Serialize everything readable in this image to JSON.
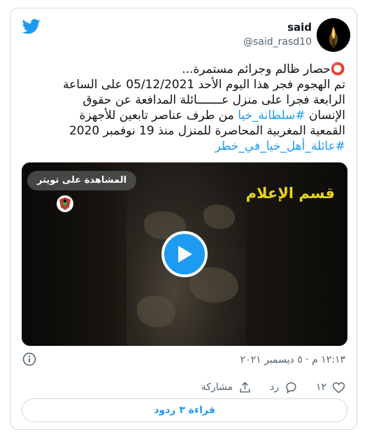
{
  "author": {
    "name": "said",
    "handle": "@said_rasd10"
  },
  "tweet": {
    "lines": [
      {
        "parts": [
          {
            "text": "⭕حصار ظالم  وجرائم مستمرة...",
            "hl": false
          }
        ]
      },
      {
        "parts": [
          {
            "text": "تم الهجوم فجر هذا اليوم الأحد 05/12/2021 على الساعة",
            "hl": false
          }
        ]
      },
      {
        "parts": [
          {
            "text": "الرابعة فجرا على منزل عـــــــائلة المدافعة عن حقوق",
            "hl": false
          }
        ]
      },
      {
        "parts": [
          {
            "text": "الإنسان ",
            "hl": false
          },
          {
            "text": "#سلطانة_خيا",
            "hl": true
          },
          {
            "text": "  من طرف عناصر تابعين للأجهزة",
            "hl": false
          }
        ]
      },
      {
        "parts": [
          {
            "text": "القمعية المغربية المحاصرة للمنزل منذ  19 نوفمبر 2020",
            "hl": false
          }
        ]
      },
      {
        "parts": [
          {
            "text": "#عائلة_أهل_خيا_في_خطر",
            "hl": true
          }
        ]
      }
    ]
  },
  "media": {
    "watch_label": "المشاهدة على تويتر",
    "overlay_text": "قسم الإعلام"
  },
  "meta": {
    "timestamp": "١٢:١٣ م · ٥ ديسمبر ٢٠٢١"
  },
  "actions": {
    "like_count": "١٢",
    "reply_label": "رد",
    "share_label": "مشاركة"
  },
  "replies_button": "قراءة ٣ ردود",
  "colors": {
    "accent": "#1d9bf0",
    "muted": "#536471",
    "border": "#cfd9de"
  }
}
